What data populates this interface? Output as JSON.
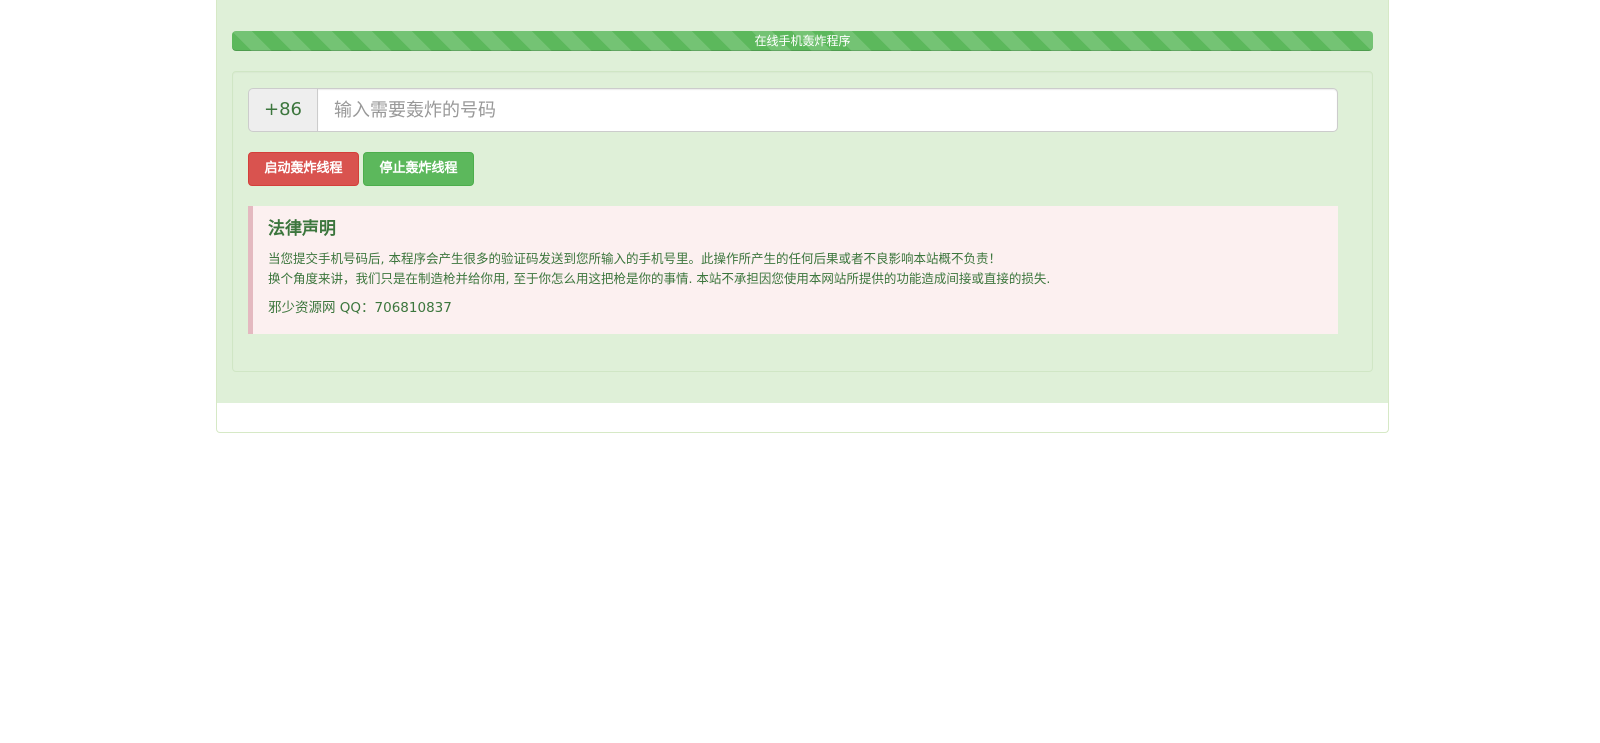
{
  "progress": {
    "label": "在线手机轰炸程序",
    "percent": 100,
    "color": "#5cb85c"
  },
  "form": {
    "country_code": "+86",
    "phone_placeholder": "输入需要轰炸的号码",
    "phone_value": ""
  },
  "buttons": {
    "start_label": "启动轰炸线程",
    "start_color": "#d9534f",
    "stop_label": "停止轰炸线程",
    "stop_color": "#5cb85c"
  },
  "notice": {
    "title": "法律声明",
    "line1": "当您提交手机号码后, 本程序会产生很多的验证码发送到您所输入的手机号里。此操作所产生的任何后果或者不良影响本站概不负责！",
    "line2": "换个角度来讲，我们只是在制造枪并给你用, 至于你怎么用这把枪是你的事情. 本站不承担因您使用本网站所提供的功能造成间接或直接的损失.",
    "contact": "邪少资源网 QQ：706810837"
  },
  "colors": {
    "panel_background": "#dff0d8",
    "text_green": "#3c763d",
    "notice_background": "#fcf0f0",
    "notice_border": "#e4b9c0"
  }
}
